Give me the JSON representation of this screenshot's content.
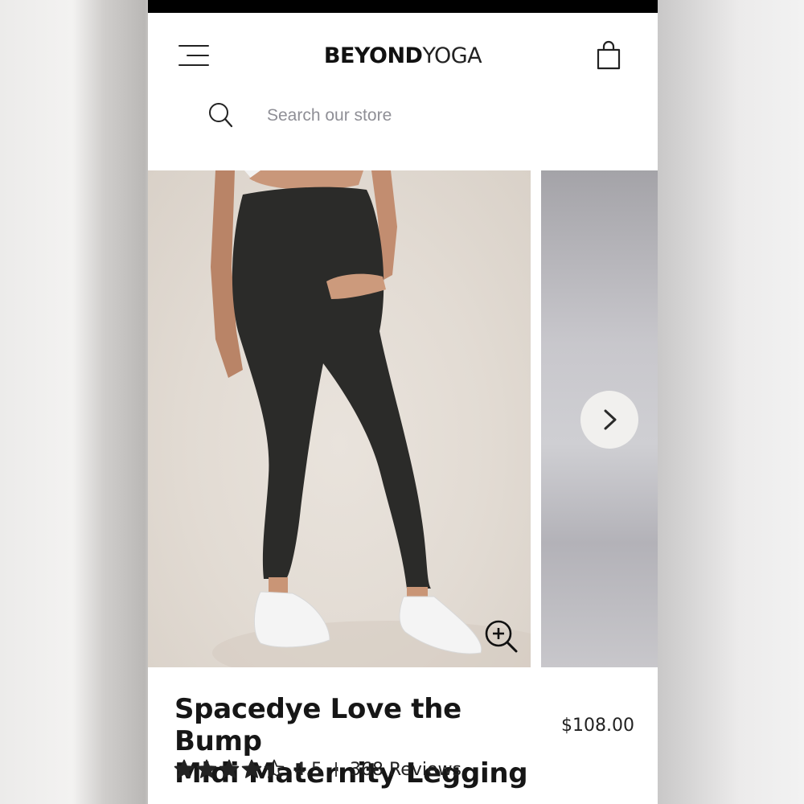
{
  "header": {
    "logo_part1": "BEYOND",
    "logo_part2": "YOGA",
    "search_placeholder": "Search our store"
  },
  "icons": {
    "menu": "hamburger-menu-icon",
    "bag": "shopping-bag-icon",
    "search": "search-icon",
    "next": "chevron-right-icon",
    "zoom": "zoom-in-icon",
    "star": "star-icon"
  },
  "product": {
    "title_line1": "Spacedye Love the Bump",
    "title_line2": "Midi Maternity Legging",
    "price": "$108.00",
    "rating_value": "4.5",
    "rating": 4.5,
    "rating_max": 5,
    "reviews": "368 Reviews"
  },
  "colors": {
    "text": "#161616",
    "placeholder": "#8f8f96",
    "legging": "#2b2b29",
    "background_photo": "#e3dcd4"
  }
}
